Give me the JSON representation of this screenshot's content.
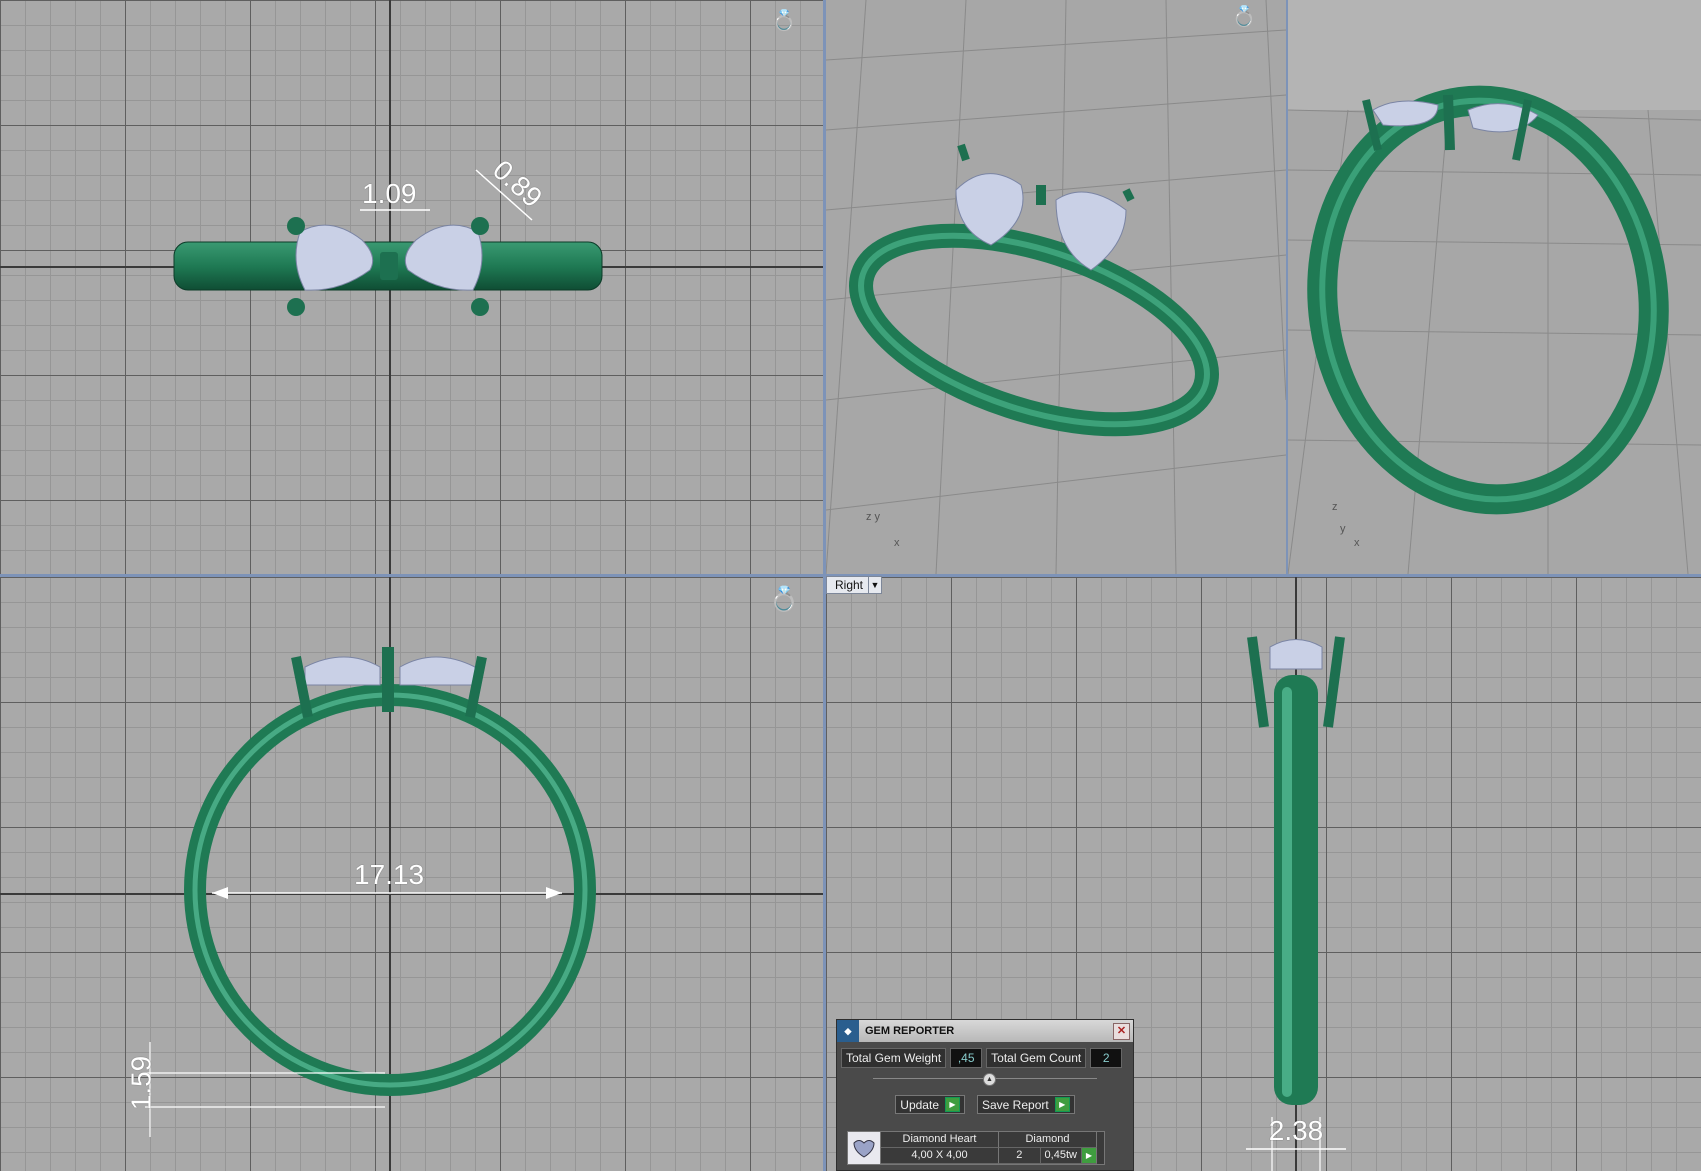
{
  "viewports": {
    "top": {
      "dimensions": [
        "1.09",
        "0.89"
      ]
    },
    "front": {
      "dimensions": [
        "17.13",
        "1.59"
      ]
    },
    "right": {
      "label": "Right",
      "dimensions": [
        "2.38"
      ]
    },
    "perspective_axes": [
      "z",
      "y",
      "x"
    ],
    "perspective2_axes": [
      "z",
      "y",
      "x"
    ]
  },
  "gem_reporter": {
    "title": "GEM REPORTER",
    "total_weight_label": "Total Gem Weight",
    "total_weight_value": ",45",
    "total_count_label": "Total Gem Count",
    "total_count_value": "2",
    "update_label": "Update",
    "save_label": "Save Report",
    "row": {
      "name": "Diamond Heart",
      "size": "4,00 X 4,00",
      "type": "Diamond",
      "count": "2",
      "weight": "0,45tw"
    }
  },
  "colors": {
    "metal": "#1f7a54",
    "gem": "#c9d0e6",
    "grid_bg": "#a9a9a9",
    "separator": "#7d93b8"
  }
}
